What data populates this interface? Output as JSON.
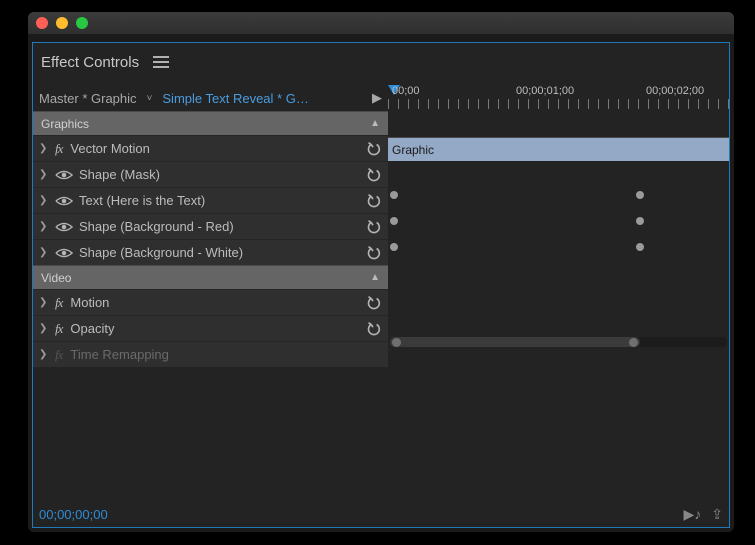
{
  "panel": {
    "title": "Effect Controls"
  },
  "breadcrumb": {
    "master": "Master * Graphic",
    "sequence": "Simple Text Reveal * G…"
  },
  "timeline": {
    "labels": [
      "00;00",
      "00;00;01;00",
      "00;00;02;00"
    ],
    "clip_label": "Graphic"
  },
  "groups": [
    {
      "label": "Graphics"
    },
    {
      "label": "Video"
    }
  ],
  "graphics_rows": [
    {
      "name": "vector-motion",
      "icon": "fx",
      "label": "Vector Motion",
      "reset": true
    },
    {
      "name": "shape-mask",
      "icon": "eye",
      "label": "Shape (Mask)",
      "reset": true
    },
    {
      "name": "text",
      "icon": "eye",
      "label": "Text (Here is the Text)",
      "reset": true,
      "kf": true
    },
    {
      "name": "shape-bg-red",
      "icon": "eye",
      "label": "Shape (Background - Red)",
      "reset": true,
      "kf": true
    },
    {
      "name": "shape-bg-white",
      "icon": "eye",
      "label": "Shape (Background - White)",
      "reset": true,
      "kf": true
    }
  ],
  "video_rows": [
    {
      "name": "motion",
      "icon": "fx",
      "label": "Motion",
      "reset": true
    },
    {
      "name": "opacity",
      "icon": "fx",
      "label": "Opacity",
      "reset": true
    },
    {
      "name": "time-remapping",
      "icon": "fx-dim",
      "label": "Time Remapping",
      "reset": false
    }
  ],
  "footer": {
    "timecode": "00;00;00;00"
  }
}
